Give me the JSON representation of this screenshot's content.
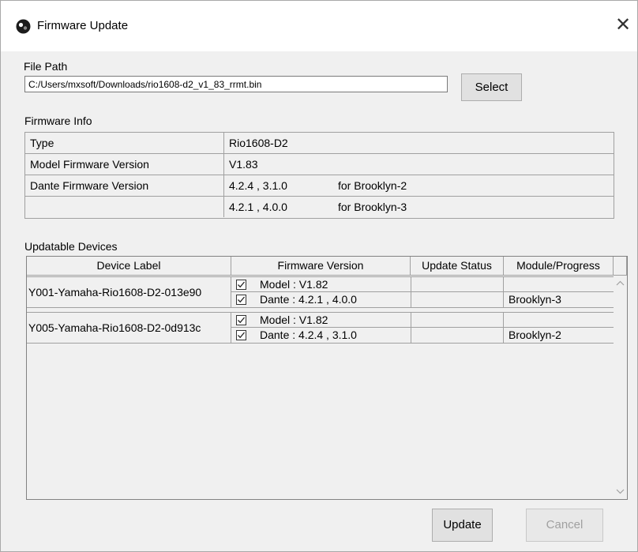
{
  "window": {
    "title": "Firmware Update",
    "close_glyph": "✕",
    "app_icon": "app-logo-icon"
  },
  "file_path": {
    "label": "File Path",
    "value": "C:/Users/mxsoft/Downloads/rio1608-d2_v1_83_rrmt.bin",
    "select_label": "Select"
  },
  "firmware_info": {
    "label": "Firmware Info",
    "rows": [
      {
        "key": "Type",
        "value": "Rio1608-D2",
        "extra": ""
      },
      {
        "key": "Model Firmware Version",
        "value": "V1.83",
        "extra": ""
      },
      {
        "key": "Dante Firmware Version",
        "value": "4.2.4  ,   3.1.0",
        "extra": "for Brooklyn-2"
      },
      {
        "key": "",
        "value": "4.2.1  ,   4.0.0",
        "extra": "for Brooklyn-3"
      }
    ]
  },
  "devices": {
    "label": "Updatable Devices",
    "columns": [
      "Device Label",
      "Firmware Version",
      "Update Status",
      "Module/Progress"
    ],
    "rows": [
      {
        "label": "Y001-Yamaha-Rio1608-D2-013e90",
        "model": "Model : V1.82",
        "dante": "Dante : 4.2.1 ,  4.0.0",
        "model_checked": true,
        "dante_checked": true,
        "model_status": "",
        "dante_status": "",
        "model_module": "",
        "dante_module": "Brooklyn-3"
      },
      {
        "label": "Y005-Yamaha-Rio1608-D2-0d913c",
        "model": "Model : V1.82",
        "dante": "Dante : 4.2.4 ,  3.1.0",
        "model_checked": true,
        "dante_checked": true,
        "model_status": "",
        "dante_status": "",
        "model_module": "",
        "dante_module": "Brooklyn-2"
      }
    ]
  },
  "footer": {
    "update_label": "Update",
    "cancel_label": "Cancel",
    "cancel_enabled": false
  }
}
